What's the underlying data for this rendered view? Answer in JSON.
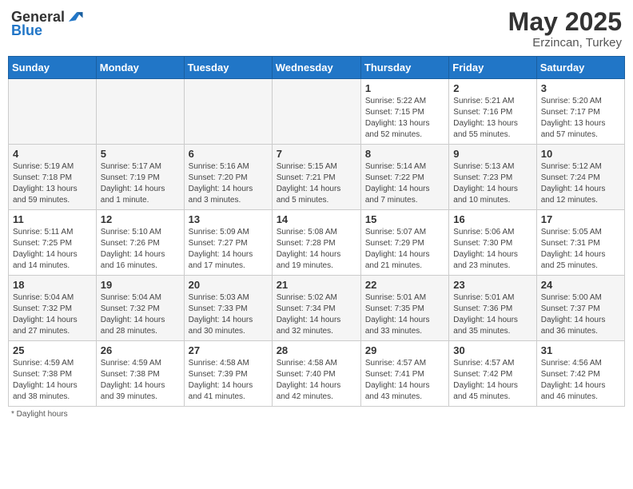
{
  "header": {
    "logo_general": "General",
    "logo_blue": "Blue",
    "month": "May 2025",
    "location": "Erzincan, Turkey"
  },
  "weekdays": [
    "Sunday",
    "Monday",
    "Tuesday",
    "Wednesday",
    "Thursday",
    "Friday",
    "Saturday"
  ],
  "footer": {
    "note": "Daylight hours"
  },
  "weeks": [
    {
      "days": [
        {
          "num": "",
          "info": ""
        },
        {
          "num": "",
          "info": ""
        },
        {
          "num": "",
          "info": ""
        },
        {
          "num": "",
          "info": ""
        },
        {
          "num": "1",
          "info": "Sunrise: 5:22 AM\nSunset: 7:15 PM\nDaylight: 13 hours\nand 52 minutes."
        },
        {
          "num": "2",
          "info": "Sunrise: 5:21 AM\nSunset: 7:16 PM\nDaylight: 13 hours\nand 55 minutes."
        },
        {
          "num": "3",
          "info": "Sunrise: 5:20 AM\nSunset: 7:17 PM\nDaylight: 13 hours\nand 57 minutes."
        }
      ]
    },
    {
      "days": [
        {
          "num": "4",
          "info": "Sunrise: 5:19 AM\nSunset: 7:18 PM\nDaylight: 13 hours\nand 59 minutes."
        },
        {
          "num": "5",
          "info": "Sunrise: 5:17 AM\nSunset: 7:19 PM\nDaylight: 14 hours\nand 1 minute."
        },
        {
          "num": "6",
          "info": "Sunrise: 5:16 AM\nSunset: 7:20 PM\nDaylight: 14 hours\nand 3 minutes."
        },
        {
          "num": "7",
          "info": "Sunrise: 5:15 AM\nSunset: 7:21 PM\nDaylight: 14 hours\nand 5 minutes."
        },
        {
          "num": "8",
          "info": "Sunrise: 5:14 AM\nSunset: 7:22 PM\nDaylight: 14 hours\nand 7 minutes."
        },
        {
          "num": "9",
          "info": "Sunrise: 5:13 AM\nSunset: 7:23 PM\nDaylight: 14 hours\nand 10 minutes."
        },
        {
          "num": "10",
          "info": "Sunrise: 5:12 AM\nSunset: 7:24 PM\nDaylight: 14 hours\nand 12 minutes."
        }
      ]
    },
    {
      "days": [
        {
          "num": "11",
          "info": "Sunrise: 5:11 AM\nSunset: 7:25 PM\nDaylight: 14 hours\nand 14 minutes."
        },
        {
          "num": "12",
          "info": "Sunrise: 5:10 AM\nSunset: 7:26 PM\nDaylight: 14 hours\nand 16 minutes."
        },
        {
          "num": "13",
          "info": "Sunrise: 5:09 AM\nSunset: 7:27 PM\nDaylight: 14 hours\nand 17 minutes."
        },
        {
          "num": "14",
          "info": "Sunrise: 5:08 AM\nSunset: 7:28 PM\nDaylight: 14 hours\nand 19 minutes."
        },
        {
          "num": "15",
          "info": "Sunrise: 5:07 AM\nSunset: 7:29 PM\nDaylight: 14 hours\nand 21 minutes."
        },
        {
          "num": "16",
          "info": "Sunrise: 5:06 AM\nSunset: 7:30 PM\nDaylight: 14 hours\nand 23 minutes."
        },
        {
          "num": "17",
          "info": "Sunrise: 5:05 AM\nSunset: 7:31 PM\nDaylight: 14 hours\nand 25 minutes."
        }
      ]
    },
    {
      "days": [
        {
          "num": "18",
          "info": "Sunrise: 5:04 AM\nSunset: 7:32 PM\nDaylight: 14 hours\nand 27 minutes."
        },
        {
          "num": "19",
          "info": "Sunrise: 5:04 AM\nSunset: 7:32 PM\nDaylight: 14 hours\nand 28 minutes."
        },
        {
          "num": "20",
          "info": "Sunrise: 5:03 AM\nSunset: 7:33 PM\nDaylight: 14 hours\nand 30 minutes."
        },
        {
          "num": "21",
          "info": "Sunrise: 5:02 AM\nSunset: 7:34 PM\nDaylight: 14 hours\nand 32 minutes."
        },
        {
          "num": "22",
          "info": "Sunrise: 5:01 AM\nSunset: 7:35 PM\nDaylight: 14 hours\nand 33 minutes."
        },
        {
          "num": "23",
          "info": "Sunrise: 5:01 AM\nSunset: 7:36 PM\nDaylight: 14 hours\nand 35 minutes."
        },
        {
          "num": "24",
          "info": "Sunrise: 5:00 AM\nSunset: 7:37 PM\nDaylight: 14 hours\nand 36 minutes."
        }
      ]
    },
    {
      "days": [
        {
          "num": "25",
          "info": "Sunrise: 4:59 AM\nSunset: 7:38 PM\nDaylight: 14 hours\nand 38 minutes."
        },
        {
          "num": "26",
          "info": "Sunrise: 4:59 AM\nSunset: 7:38 PM\nDaylight: 14 hours\nand 39 minutes."
        },
        {
          "num": "27",
          "info": "Sunrise: 4:58 AM\nSunset: 7:39 PM\nDaylight: 14 hours\nand 41 minutes."
        },
        {
          "num": "28",
          "info": "Sunrise: 4:58 AM\nSunset: 7:40 PM\nDaylight: 14 hours\nand 42 minutes."
        },
        {
          "num": "29",
          "info": "Sunrise: 4:57 AM\nSunset: 7:41 PM\nDaylight: 14 hours\nand 43 minutes."
        },
        {
          "num": "30",
          "info": "Sunrise: 4:57 AM\nSunset: 7:42 PM\nDaylight: 14 hours\nand 45 minutes."
        },
        {
          "num": "31",
          "info": "Sunrise: 4:56 AM\nSunset: 7:42 PM\nDaylight: 14 hours\nand 46 minutes."
        }
      ]
    }
  ]
}
